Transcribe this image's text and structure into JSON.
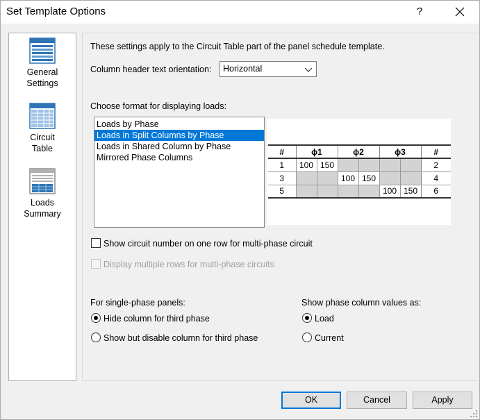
{
  "window": {
    "title": "Set Template Options",
    "help_label": "?"
  },
  "sidebar": {
    "items": [
      {
        "label": "General\nSettings",
        "icon": "general-settings-icon"
      },
      {
        "label": "Circuit\nTable",
        "icon": "circuit-table-icon"
      },
      {
        "label": "Loads\nSummary",
        "icon": "loads-summary-icon"
      }
    ],
    "active": "Circuit Table"
  },
  "circuit_table": {
    "description": "These settings apply to the Circuit Table part of the panel schedule template.",
    "orientation_label": "Column header text orientation:",
    "orientation_value": "Horizontal",
    "format_label": "Choose format for displaying loads:",
    "formats": [
      "Loads by Phase",
      "Loads in Split Columns by Phase",
      "Loads in Shared Column by Phase",
      "Mirrored Phase Columns"
    ],
    "selected_format": "Loads in Split Columns by Phase",
    "preview": {
      "headers": [
        "#",
        "ϕ1",
        "ϕ2",
        "ϕ3",
        "#"
      ],
      "rows": [
        {
          "left": "1",
          "cells": [
            "100",
            "150",
            "",
            "",
            "",
            ""
          ],
          "right": "2"
        },
        {
          "left": "3",
          "cells": [
            "",
            "",
            "100",
            "150",
            "",
            ""
          ],
          "right": "4"
        },
        {
          "left": "5",
          "cells": [
            "",
            "",
            "",
            "",
            "100",
            "150"
          ],
          "right": "6"
        }
      ]
    },
    "show_circuit_one_row_label": "Show circuit number on one row for multi-phase circuit",
    "show_circuit_one_row_checked": false,
    "display_multiple_rows_label": "Display multiple rows for multi-phase circuits",
    "display_multiple_rows_enabled": false,
    "single_phase_label": "For single-phase panels:",
    "single_phase_options": [
      "Hide column for third phase",
      "Show but disable column for third phase"
    ],
    "single_phase_selected": "Hide column for third phase",
    "phase_values_label": "Show phase column values as:",
    "phase_values_options": [
      "Load",
      "Current"
    ],
    "phase_values_selected": "Load"
  },
  "buttons": {
    "ok": "OK",
    "cancel": "Cancel",
    "apply": "Apply"
  },
  "colors": {
    "selection": "#0078d7",
    "icon_blue": "#2e75b6"
  }
}
